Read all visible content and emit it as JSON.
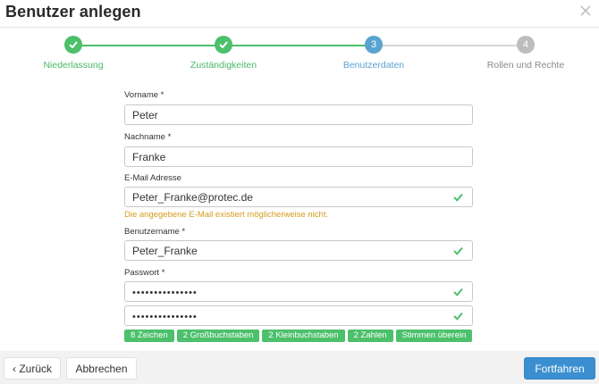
{
  "dialog": {
    "title": "Benutzer anlegen"
  },
  "colors": {
    "done": "#4cc06b",
    "active": "#5aa3d0",
    "todo": "#bdbdbd",
    "warning": "#d79b19",
    "primary": "#3b8fd0"
  },
  "stepper": {
    "steps": [
      {
        "label": "Niederlassung",
        "state": "done",
        "icon": "check-icon"
      },
      {
        "label": "Zuständigkeiten",
        "state": "done",
        "icon": "check-icon"
      },
      {
        "label": "Benutzerdaten",
        "state": "active",
        "number": "3"
      },
      {
        "label": "Rollen und Rechte",
        "state": "todo",
        "number": "4"
      }
    ]
  },
  "form": {
    "vorname": {
      "label": "Vorname *",
      "value": "Peter"
    },
    "nachname": {
      "label": "Nachname *",
      "value": "Franke"
    },
    "email": {
      "label": "E-Mail Adresse",
      "value": "Peter_Franke@protec.de",
      "warning": "Die angegebene E-Mail existiert möglicherweise nicht."
    },
    "benutzername": {
      "label": "Benutzername *",
      "value": "Peter_Franke"
    },
    "passwort": {
      "label": "Passwort *",
      "value": "•••••••••••••••",
      "confirm_value": "•••••••••••••••"
    },
    "password_rules": [
      "8 Zeichen",
      "2 Großbuchstaben",
      "2 Kleinbuchstaben",
      "2 Zahlen",
      "Stimmen überein"
    ]
  },
  "footer": {
    "back_label": "‹ Zurück",
    "cancel_label": "Abbrechen",
    "next_label": "Fortfahren"
  }
}
